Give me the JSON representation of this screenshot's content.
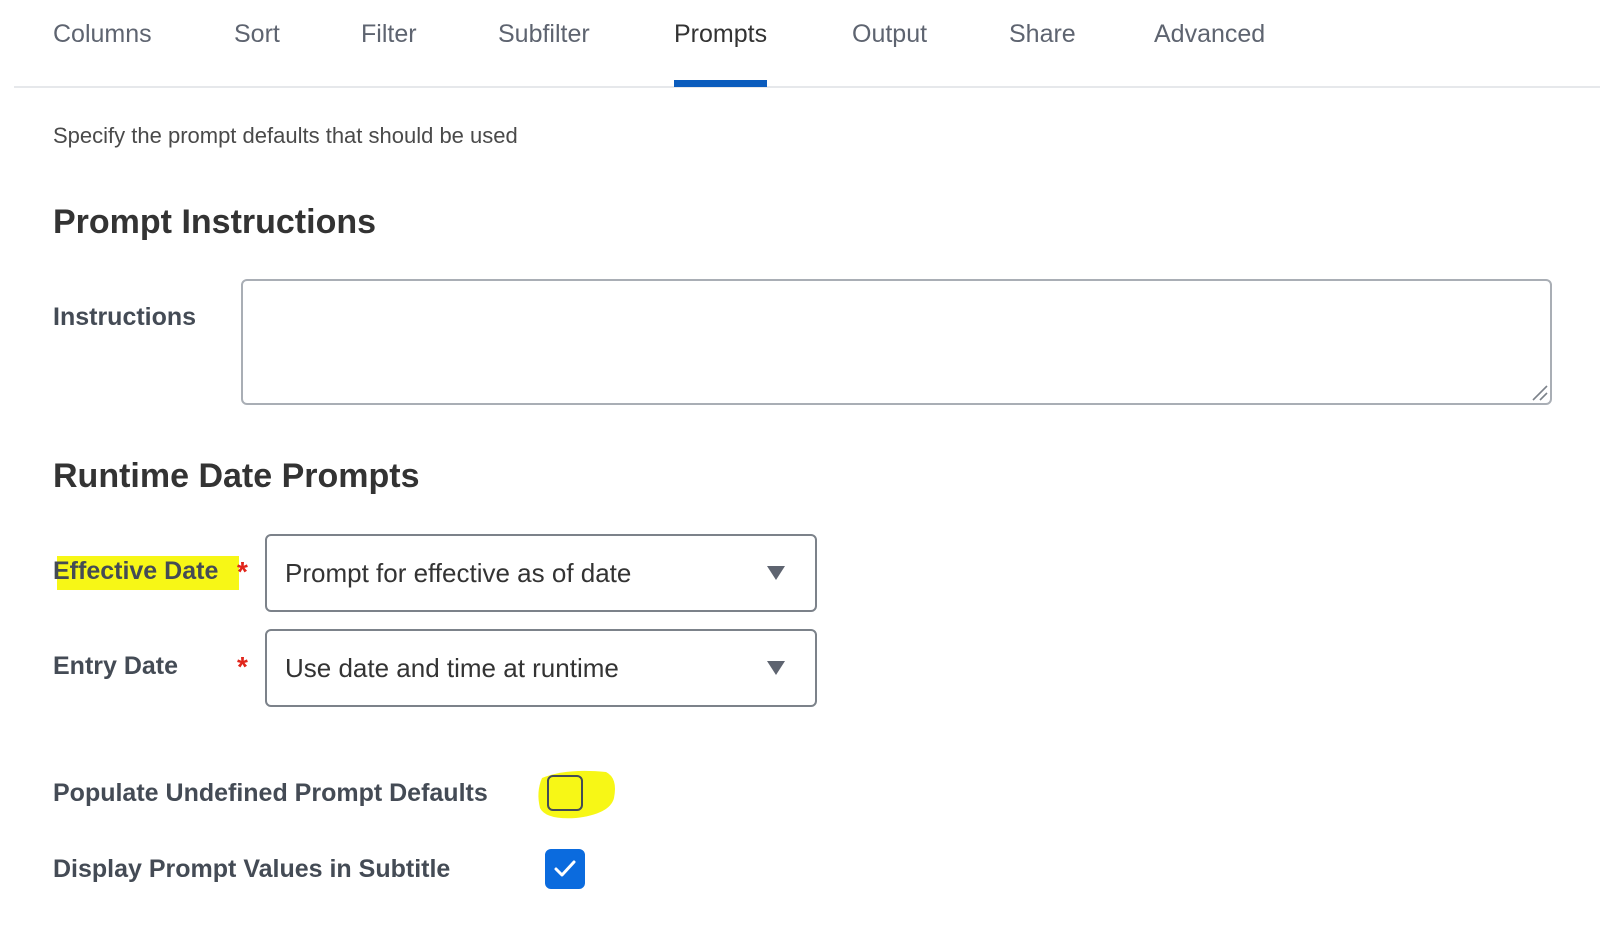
{
  "tabs": [
    {
      "label": "Columns",
      "active": false
    },
    {
      "label": "Sort",
      "active": false
    },
    {
      "label": "Filter",
      "active": false
    },
    {
      "label": "Subfilter",
      "active": false
    },
    {
      "label": "Prompts",
      "active": true
    },
    {
      "label": "Output",
      "active": false
    },
    {
      "label": "Share",
      "active": false
    },
    {
      "label": "Advanced",
      "active": false
    }
  ],
  "description": "Specify the prompt defaults that should be used",
  "prompt_instructions": {
    "title": "Prompt Instructions",
    "instructions_label": "Instructions",
    "instructions_value": ""
  },
  "runtime_date_prompts": {
    "title": "Runtime Date Prompts",
    "effective_date": {
      "label": "Effective Date",
      "required_mark": "*",
      "selected": "Prompt for effective as of date"
    },
    "entry_date": {
      "label": "Entry Date",
      "required_mark": "*",
      "selected": "Use date and time at runtime"
    }
  },
  "options": {
    "populate_undefined": {
      "label": "Populate Undefined Prompt Defaults",
      "checked": false
    },
    "display_prompt_values": {
      "label": "Display Prompt Values in Subtitle",
      "checked": true
    }
  },
  "colors": {
    "accent": "#0b5cbd",
    "checkbox_checked": "#0b6bde",
    "required": "#e1251b",
    "highlight": "#f7f716"
  }
}
